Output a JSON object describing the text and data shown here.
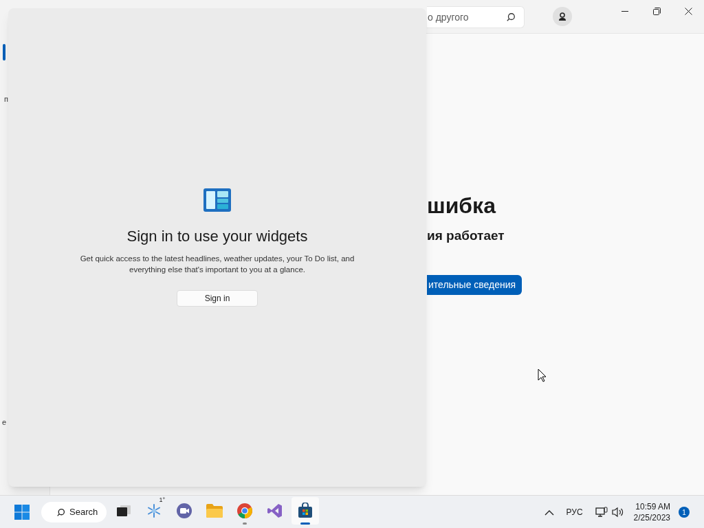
{
  "store_window": {
    "search": {
      "value": "о другого"
    },
    "sidebar": {
      "items": [
        {
          "selected": true
        },
        {
          "label": "п",
          "selected": false
        },
        {
          "label": "е",
          "selected": false
        }
      ]
    },
    "error": {
      "title": "шибка",
      "message": "ия работает",
      "button": "ительные сведения"
    }
  },
  "widgets_panel": {
    "title": "Sign in to use your widgets",
    "description": "Get quick access to the latest headlines, weather updates, your To Do list, and everything else that's important to you at a glance.",
    "button": "Sign in"
  },
  "taskbar": {
    "search_label": "Search",
    "apps": [
      {
        "kind": "taskview",
        "running": false,
        "active": false
      },
      {
        "kind": "weather",
        "badge": "1°",
        "running": false,
        "active": false
      },
      {
        "kind": "meet",
        "running": false,
        "active": false
      },
      {
        "kind": "folder",
        "running": false,
        "active": false
      },
      {
        "kind": "chrome",
        "running": true,
        "active": false
      },
      {
        "kind": "vs",
        "running": false,
        "active": false
      },
      {
        "kind": "store",
        "running": true,
        "active": true
      }
    ],
    "tray": {
      "language": "РУС",
      "time": "10:59 AM",
      "date": "2/25/2023",
      "notifications": "1"
    }
  }
}
